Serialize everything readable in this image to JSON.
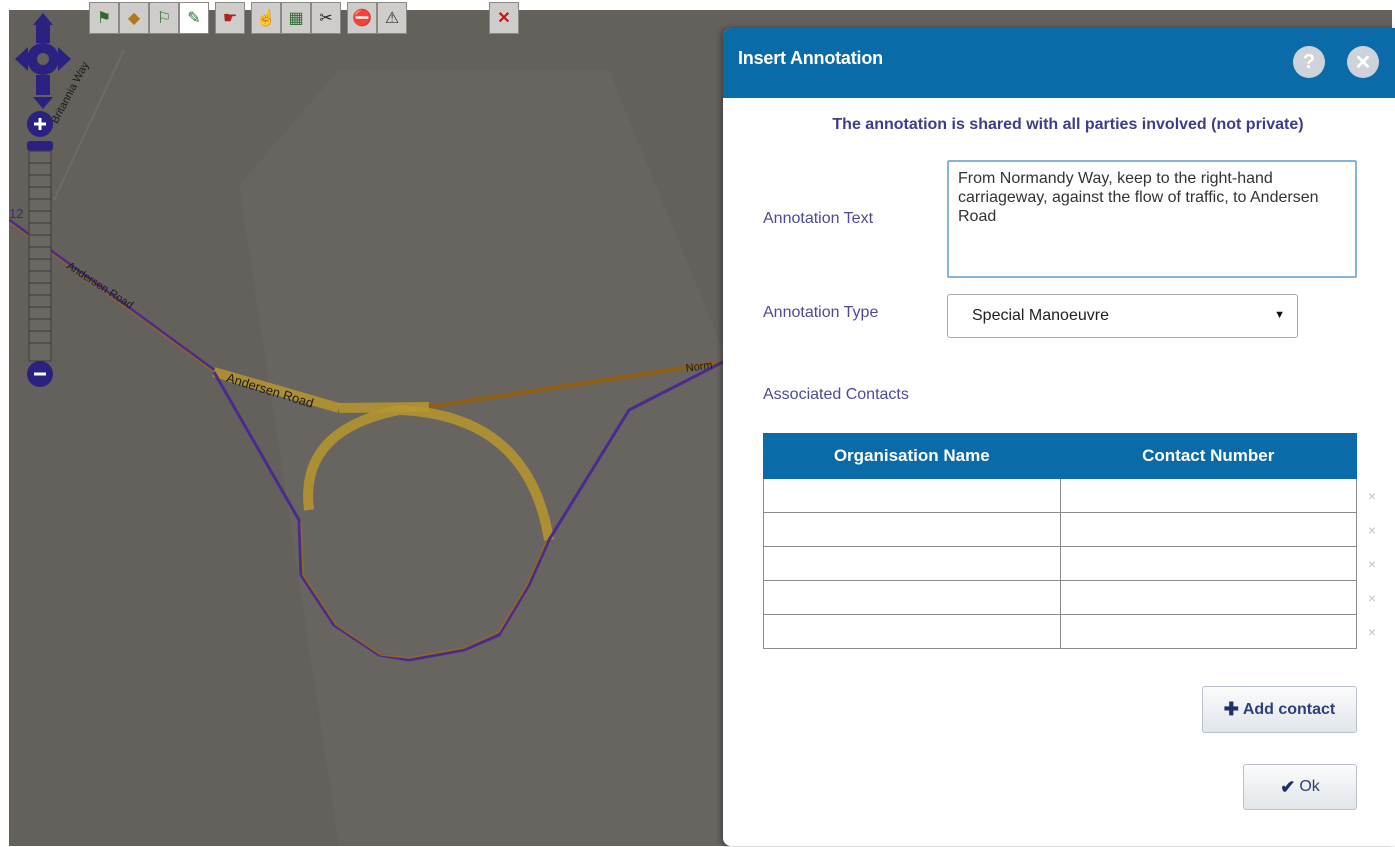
{
  "map": {
    "zoom_level": "12",
    "road_labels": {
      "britannia_way": "Britannia Way",
      "andersen_road_upper": "Andersen Road",
      "andersen_road_main": "Andersen Road",
      "normandy_way_fragment": "Norm"
    },
    "colors": {
      "background": "#64605c",
      "route_purple": "#4b2a8f",
      "route_orange": "#9a6a14",
      "roundabout_yellow": "#b8972e"
    }
  },
  "toolbar": {
    "icons": [
      "flags-icon",
      "diamond-sign-icon",
      "flags-outline-icon",
      "pencil-icon",
      "hand-cut-icon",
      "hand-flag-icon",
      "hand-grid-icon",
      "scissors-icon",
      "no-entry-icon",
      "warning-icon",
      "clear-icon"
    ]
  },
  "dialog": {
    "title": "Insert Annotation",
    "help_symbol": "?",
    "close_symbol": "✕",
    "notice": "The annotation is shared with all parties involved (not private)",
    "annotation_text_label": "Annotation Text",
    "annotation_text_value": "From Normandy Way, keep to the right-hand carriageway, against the flow of traffic, to Andersen Road",
    "annotation_type_label": "Annotation Type",
    "annotation_type_value": "Special Manoeuvre",
    "contacts_label": "Associated Contacts",
    "table_headers": [
      "Organisation Name",
      "Contact Number"
    ],
    "table_rows": [
      [
        "",
        ""
      ],
      [
        "",
        ""
      ],
      [
        "",
        ""
      ],
      [
        "",
        ""
      ],
      [
        "",
        ""
      ]
    ],
    "remove_symbol": "×",
    "add_contact_label": "Add contact",
    "ok_label": "Ok",
    "colors": {
      "header": "#0b6aa8",
      "label_text": "#4d4a9a"
    }
  }
}
